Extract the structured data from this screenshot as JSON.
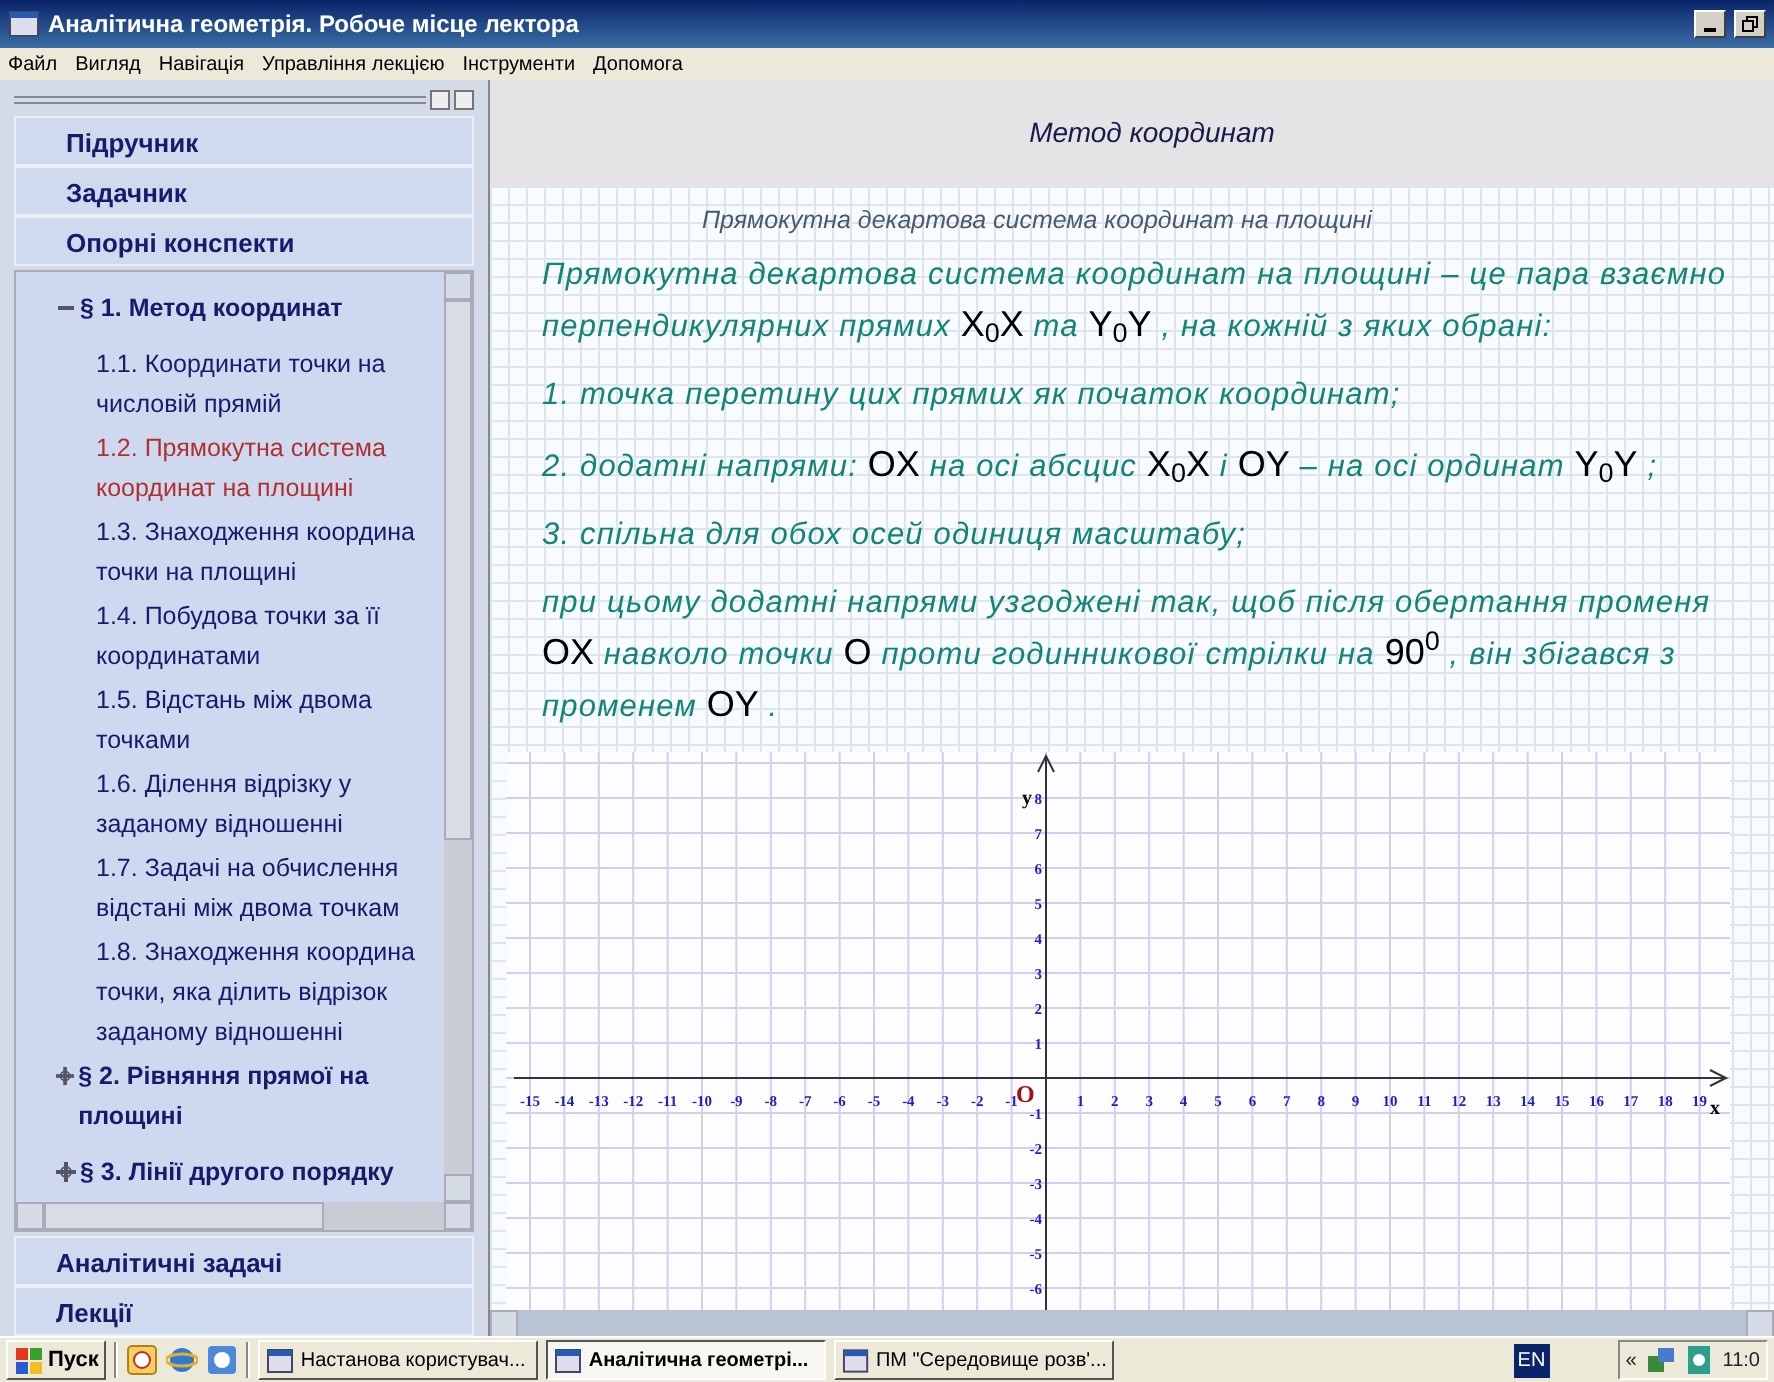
{
  "window": {
    "title": "Аналітична геометрія. Робоче місце лектора"
  },
  "menu": [
    "Файл",
    "Вигляд",
    "Навігація",
    "Управління лекцією",
    "Інструменти",
    "Допомога"
  ],
  "sidebar": {
    "top_sections": [
      "Підручник",
      "Задачник",
      "Опорні конспекти"
    ],
    "tree": [
      {
        "label": "§ 1. Метод координат",
        "expanded": true,
        "children": [
          {
            "lines": [
              "1.1. Координати точки на",
              "числовій прямій"
            ],
            "selected": false
          },
          {
            "lines": [
              "1.2. Прямокутна система",
              "координат на площині"
            ],
            "selected": true
          },
          {
            "lines": [
              "1.3. Знаходження координа",
              "точки на площині"
            ],
            "selected": false
          },
          {
            "lines": [
              "1.4. Побудова точки за її",
              "координатами"
            ],
            "selected": false
          },
          {
            "lines": [
              "1.5. Відстань між двома",
              "точками"
            ],
            "selected": false
          },
          {
            "lines": [
              "1.6. Ділення відрізку у",
              "заданому відношенні"
            ],
            "selected": false
          },
          {
            "lines": [
              "1.7. Задачі на обчислення",
              "відстані між двома точкам"
            ],
            "selected": false
          },
          {
            "lines": [
              "1.8. Знаходження координа",
              "точки, яка ділить відрізок",
              "заданому відношенні"
            ],
            "selected": false
          }
        ]
      },
      {
        "label": "§ 2. Рівняння прямої на площині",
        "expanded": false
      },
      {
        "label": "§ 3. Лінії другого порядку",
        "expanded": false
      }
    ],
    "bottom_sections": [
      "Аналітичні задачі",
      "Лекції"
    ]
  },
  "content": {
    "heading": "Метод координат",
    "subtitle": "Прямокутна декартова система координат на площині",
    "paragraphs": [
      {
        "segments": [
          {
            "kind": "text",
            "text": "Прямокутна декартова система координат на площині – це пара взаємно перпендикулярних прямих "
          },
          {
            "kind": "math",
            "text": "X$_{0}$X"
          },
          {
            "kind": "text",
            "text": " та "
          },
          {
            "kind": "math",
            "text": "Y$_{0}$Y"
          },
          {
            "kind": "text",
            "text": " , на кожній з яких обрані:"
          }
        ]
      },
      {
        "segments": [
          {
            "kind": "text",
            "text": "1. точка перетину цих прямих як початок координат;"
          }
        ]
      },
      {
        "segments": [
          {
            "kind": "text",
            "text": "2. додатні напрями: "
          },
          {
            "kind": "math",
            "text": "OX"
          },
          {
            "kind": "text",
            "text": " на осі абсцис "
          },
          {
            "kind": "math",
            "text": "X$_{0}$X"
          },
          {
            "kind": "text",
            "text": " і "
          },
          {
            "kind": "math",
            "text": "OY"
          },
          {
            "kind": "text",
            "text": " – на осі ординат "
          },
          {
            "kind": "math",
            "text": "Y$_{0}$Y"
          },
          {
            "kind": "text",
            "text": " ;"
          }
        ]
      },
      {
        "segments": [
          {
            "kind": "text",
            "text": "3. спільна для обох осей одиниця масштабу;"
          }
        ]
      },
      {
        "segments": [
          {
            "kind": "text",
            "text": "при цьому додатні напрями узгоджені так, щоб після обертання променя "
          },
          {
            "kind": "math",
            "text": "OX"
          },
          {
            "kind": "text",
            "text": " навколо точки "
          },
          {
            "kind": "math",
            "text": "O"
          },
          {
            "kind": "text",
            "text": " проти годинникової стрілки на "
          },
          {
            "kind": "math",
            "text": "90$^{0}$"
          },
          {
            "kind": "text",
            "text": " , він збігався з променем "
          },
          {
            "kind": "math",
            "text": "OY"
          },
          {
            "kind": "text",
            "text": " ."
          }
        ]
      }
    ],
    "plot": {
      "x_axis_label": "x",
      "y_axis_label": "y",
      "origin_label": "O",
      "x_tick_labels": [
        "-15",
        "-14",
        "-13",
        "-12",
        "-11",
        "-10",
        "-9",
        "-8",
        "-7",
        "-6",
        "-5",
        "-4",
        "-3",
        "-2",
        "-1",
        "1",
        "2",
        "3",
        "4",
        "5",
        "6",
        "7",
        "8",
        "9",
        "10",
        "11",
        "12",
        "13",
        "14",
        "15",
        "16",
        "17",
        "18",
        "19"
      ],
      "y_tick_labels": [
        "8",
        "7",
        "6",
        "5",
        "4",
        "3",
        "2",
        "1",
        "-1",
        "-2",
        "-3",
        "-4",
        "-5",
        "-6"
      ]
    }
  },
  "taskbar": {
    "start": "Пуск",
    "tasks": [
      {
        "label": "Настанова користувач...",
        "selected": false
      },
      {
        "label": "Аналітична геометрі...",
        "selected": true
      },
      {
        "label": "ПМ \"Середовище розв'...",
        "selected": false
      }
    ],
    "language": "EN",
    "tray_expander": "«",
    "clock": "11:0"
  }
}
